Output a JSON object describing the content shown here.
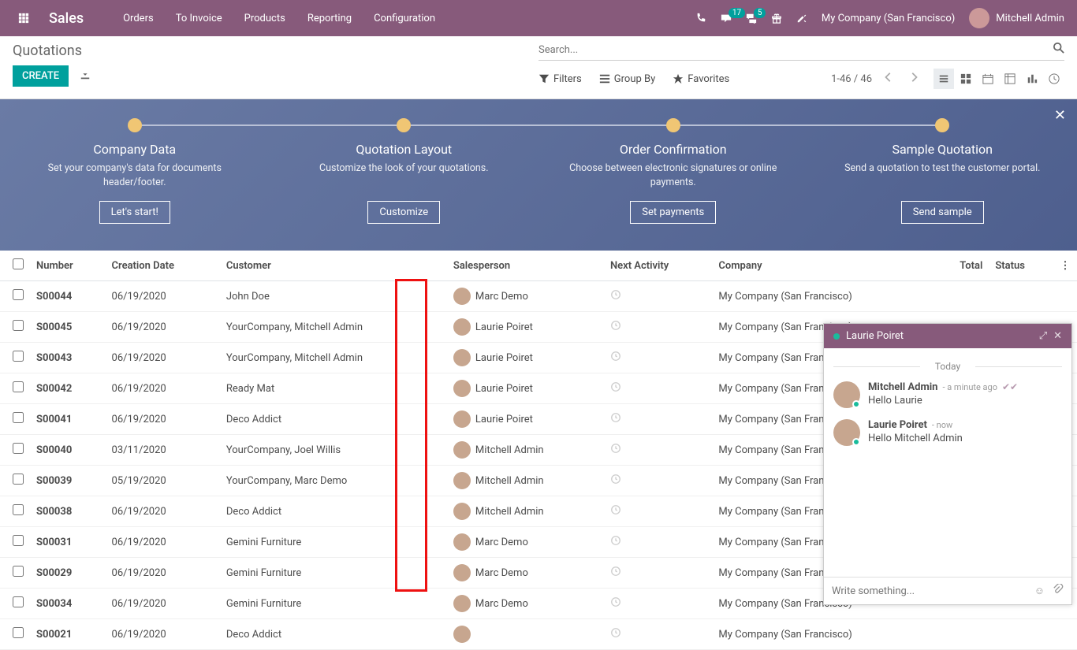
{
  "navbar": {
    "brand": "Sales",
    "menu": [
      "Orders",
      "To Invoice",
      "Products",
      "Reporting",
      "Configuration"
    ],
    "msg_badge": "17",
    "chat_badge": "5",
    "company": "My Company (San Francisco)",
    "user": "Mitchell Admin"
  },
  "controlbar": {
    "title": "Quotations",
    "create": "CREATE",
    "search_placeholder": "Search...",
    "filters": "Filters",
    "groupby": "Group By",
    "favorites": "Favorites",
    "pager": "1-46 / 46"
  },
  "banner": {
    "steps": [
      {
        "title": "Company Data",
        "desc": "Set your company's data for documents header/footer.",
        "btn": "Let's start!"
      },
      {
        "title": "Quotation Layout",
        "desc": "Customize the look of your quotations.",
        "btn": "Customize"
      },
      {
        "title": "Order Confirmation",
        "desc": "Choose between electronic signatures or online payments.",
        "btn": "Set payments"
      },
      {
        "title": "Sample Quotation",
        "desc": "Send a quotation to test the customer portal.",
        "btn": "Send sample"
      }
    ]
  },
  "table": {
    "headers": {
      "number": "Number",
      "date": "Creation Date",
      "customer": "Customer",
      "salesperson": "Salesperson",
      "activity": "Next Activity",
      "company": "Company",
      "total": "Total",
      "status": "Status"
    },
    "rows": [
      {
        "num": "S00044",
        "date": "06/19/2020",
        "customer": "John Doe",
        "sp": "Marc Demo",
        "company": "My Company (San Francisco)"
      },
      {
        "num": "S00045",
        "date": "06/19/2020",
        "customer": "YourCompany, Mitchell Admin",
        "sp": "Laurie Poiret",
        "company": "My Company (San Francisco)"
      },
      {
        "num": "S00043",
        "date": "06/19/2020",
        "customer": "YourCompany, Mitchell Admin",
        "sp": "Laurie Poiret",
        "company": "My Company (San Francisco)"
      },
      {
        "num": "S00042",
        "date": "06/19/2020",
        "customer": "Ready Mat",
        "sp": "Laurie Poiret",
        "company": "My Company (San Francisco)"
      },
      {
        "num": "S00041",
        "date": "06/19/2020",
        "customer": "Deco Addict",
        "sp": "Laurie Poiret",
        "company": "My Company (San Francisco)"
      },
      {
        "num": "S00040",
        "date": "03/11/2020",
        "customer": "YourCompany, Joel Willis",
        "sp": "Mitchell Admin",
        "company": "My Company (San Francisco)"
      },
      {
        "num": "S00039",
        "date": "05/19/2020",
        "customer": "YourCompany, Marc Demo",
        "sp": "Mitchell Admin",
        "company": "My Company (San Francisco)"
      },
      {
        "num": "S00038",
        "date": "06/19/2020",
        "customer": "Deco Addict",
        "sp": "Mitchell Admin",
        "company": "My Company (San Francisco)"
      },
      {
        "num": "S00031",
        "date": "06/19/2020",
        "customer": "Gemini Furniture",
        "sp": "Marc Demo",
        "company": "My Company (San Francisco)"
      },
      {
        "num": "S00029",
        "date": "06/19/2020",
        "customer": "Gemini Furniture",
        "sp": "Marc Demo",
        "company": "My Company (San Francisco)"
      },
      {
        "num": "S00034",
        "date": "06/19/2020",
        "customer": "Gemini Furniture",
        "sp": "Marc Demo",
        "company": "My Company (San Francisco)"
      },
      {
        "num": "S00021",
        "date": "06/19/2020",
        "customer": "Deco Addict",
        "sp": "",
        "company": "My Company (San Francisco)"
      }
    ]
  },
  "chat": {
    "title": "Laurie Poiret",
    "date": "Today",
    "messages": [
      {
        "name": "Mitchell Admin",
        "time": "- a minute ago",
        "text": "Hello Laurie",
        "check": true
      },
      {
        "name": "Laurie Poiret",
        "time": "- now",
        "text": "Hello Mitchell Admin",
        "check": false
      }
    ],
    "input_placeholder": "Write something..."
  }
}
